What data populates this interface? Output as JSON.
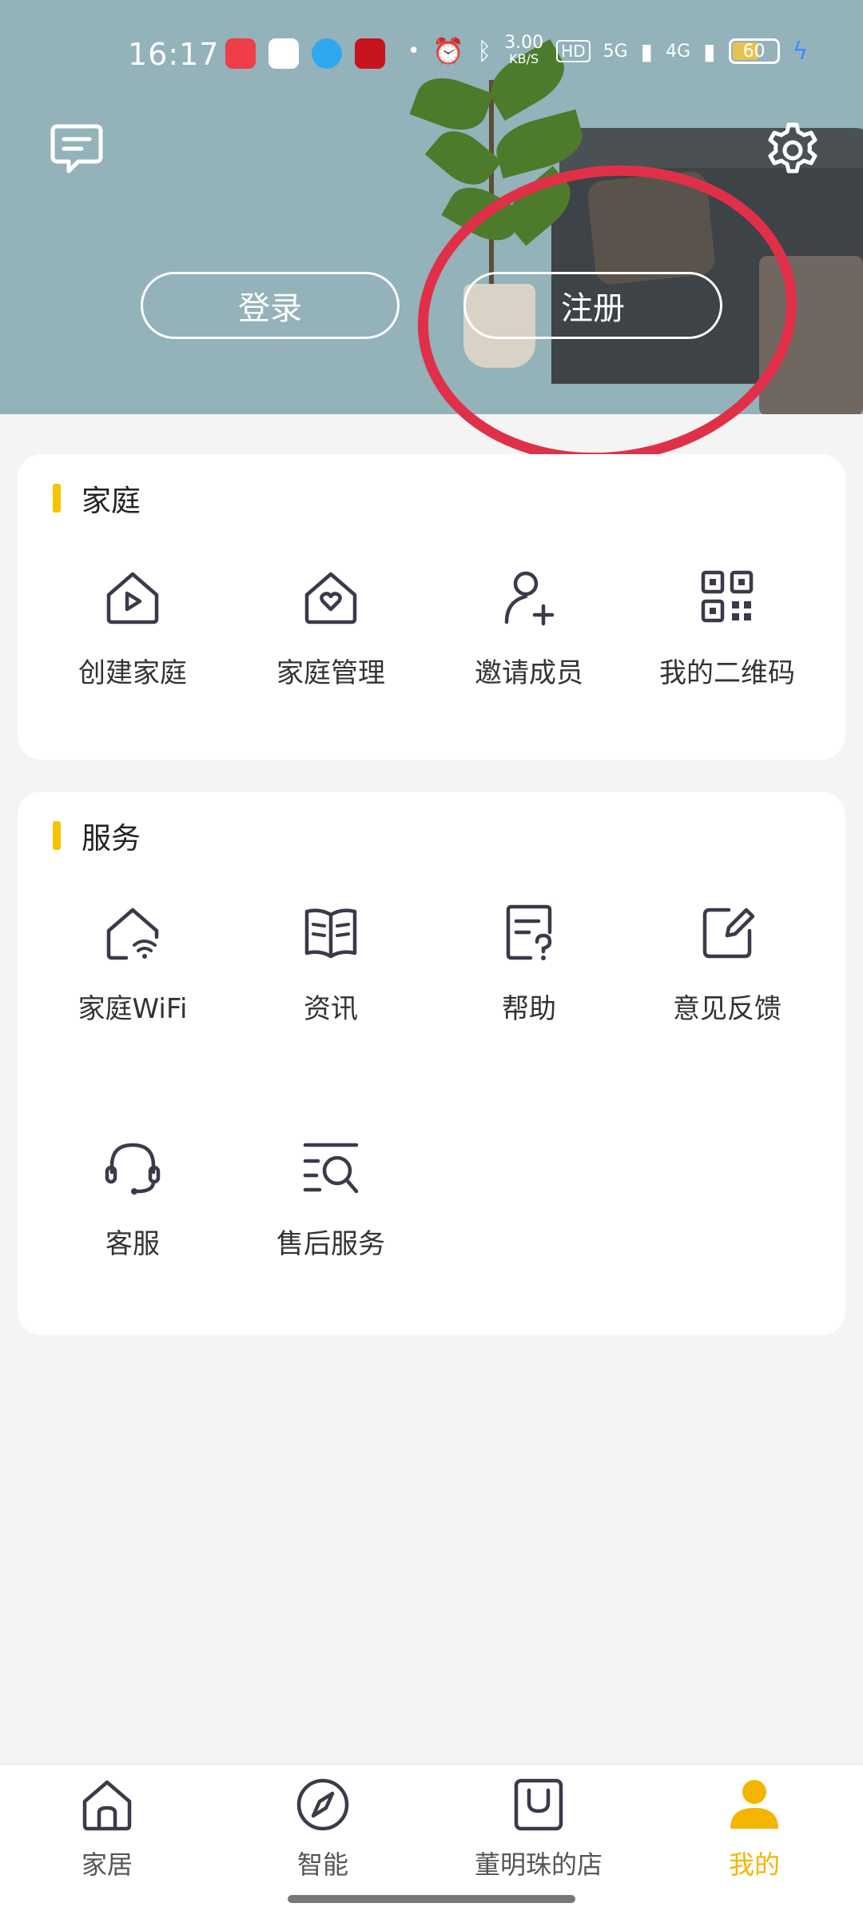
{
  "status_bar": {
    "time": "16:17",
    "speed": "3.00",
    "speed_unit": "KB/S",
    "hd": "HD",
    "net_5g": "5G",
    "net_4g": "4G",
    "battery": "60"
  },
  "header": {
    "login_label": "登录",
    "register_label": "注册"
  },
  "family": {
    "title": "家庭",
    "items": [
      {
        "label": "创建家庭",
        "icon": "house-play-icon"
      },
      {
        "label": "家庭管理",
        "icon": "house-heart-icon"
      },
      {
        "label": "邀请成员",
        "icon": "person-add-icon"
      },
      {
        "label": "我的二维码",
        "icon": "qr-code-icon"
      }
    ]
  },
  "service": {
    "title": "服务",
    "items": [
      {
        "label": "家庭WiFi",
        "icon": "house-wifi-icon"
      },
      {
        "label": "资讯",
        "icon": "book-icon"
      },
      {
        "label": "帮助",
        "icon": "help-doc-icon"
      },
      {
        "label": "意见反馈",
        "icon": "edit-note-icon"
      },
      {
        "label": "客服",
        "icon": "headset-icon"
      },
      {
        "label": "售后服务",
        "icon": "list-search-icon"
      }
    ]
  },
  "bottom_nav": {
    "items": [
      {
        "label": "家居",
        "icon": "home-icon",
        "active": false
      },
      {
        "label": "智能",
        "icon": "compass-icon",
        "active": false
      },
      {
        "label": "董明珠的店",
        "icon": "shop-bag-icon",
        "active": false
      },
      {
        "label": "我的",
        "icon": "person-icon",
        "active": true
      }
    ]
  },
  "colors": {
    "accent": "#f5b400",
    "banner": "#93b2ba",
    "highlight": "#e03048"
  }
}
